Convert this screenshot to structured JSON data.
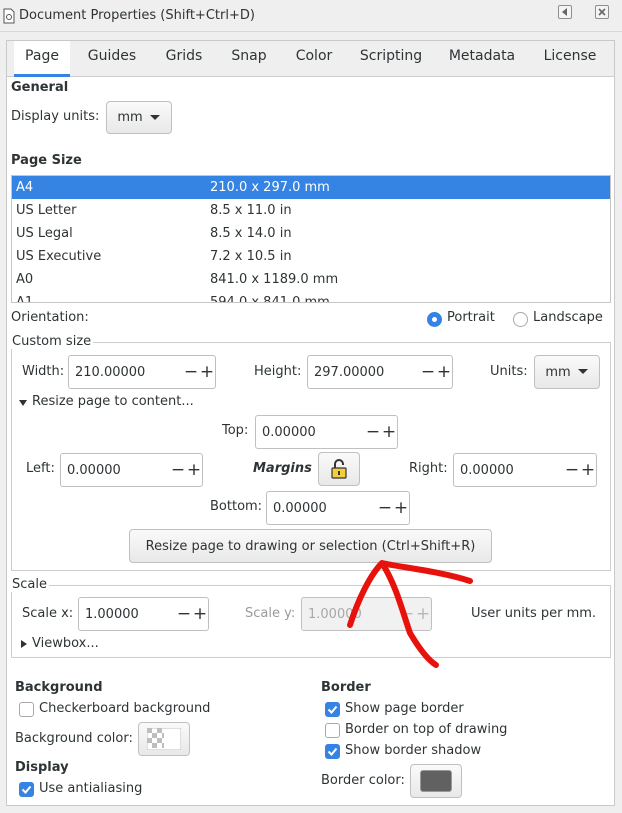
{
  "window": {
    "title": "Document Properties (Shift+Ctrl+D)"
  },
  "tabs": [
    {
      "label": "Page",
      "active": true
    },
    {
      "label": "Guides"
    },
    {
      "label": "Grids"
    },
    {
      "label": "Snap"
    },
    {
      "label": "Color"
    },
    {
      "label": "Scripting"
    },
    {
      "label": "Metadata"
    },
    {
      "label": "License"
    }
  ],
  "general": {
    "heading": "General",
    "display_units_label": "Display units:",
    "display_units_value": "mm"
  },
  "page_size": {
    "heading": "Page Size",
    "rows": [
      {
        "name": "A4",
        "size": "210.0 x 297.0 mm",
        "selected": true
      },
      {
        "name": "US Letter",
        "size": "8.5 x 11.0 in"
      },
      {
        "name": "US Legal",
        "size": "8.5 x 14.0 in"
      },
      {
        "name": "US Executive",
        "size": "7.2 x 10.5 in"
      },
      {
        "name": "A0",
        "size": "841.0 x 1189.0 mm"
      },
      {
        "name": "A1",
        "size": "594.0 x 841.0 mm"
      }
    ]
  },
  "orientation": {
    "label": "Orientation:",
    "portrait": "Portrait",
    "landscape": "Landscape",
    "selected": "Portrait"
  },
  "custom_size": {
    "label": "Custom size",
    "width_label": "Width:",
    "width_value": "210.00000",
    "height_label": "Height:",
    "height_value": "297.00000",
    "units_label": "Units:",
    "units_value": "mm",
    "resize_expander": "Resize page to content...",
    "top_label": "Top:",
    "top_value": "0.00000",
    "left_label": "Left:",
    "left_value": "0.00000",
    "margins_label": "Margins",
    "right_label": "Right:",
    "right_value": "0.00000",
    "bottom_label": "Bottom:",
    "bottom_value": "0.00000",
    "resize_button": "Resize page to drawing or selection (Ctrl+Shift+R)"
  },
  "scale": {
    "label": "Scale",
    "scale_x_label": "Scale x:",
    "scale_x_value": "1.00000",
    "scale_y_label": "Scale y:",
    "scale_y_value": "1.00000",
    "units_text": "User units per mm.",
    "viewbox_expander": "Viewbox..."
  },
  "background": {
    "heading": "Background",
    "checkerboard_label": "Checkerboard background",
    "checkerboard_checked": false,
    "color_label": "Background color:"
  },
  "display": {
    "heading": "Display",
    "antialiasing_label": "Use antialiasing",
    "antialiasing_checked": true
  },
  "border": {
    "heading": "Border",
    "show_border_label": "Show page border",
    "show_border_checked": true,
    "border_on_top_label": "Border on top of drawing",
    "border_on_top_checked": false,
    "show_shadow_label": "Show border shadow",
    "show_shadow_checked": true,
    "color_label": "Border color:"
  },
  "colors": {
    "accent": "#3584e4",
    "border_color_swatch": "#616161",
    "annotation": "#e8120c"
  }
}
